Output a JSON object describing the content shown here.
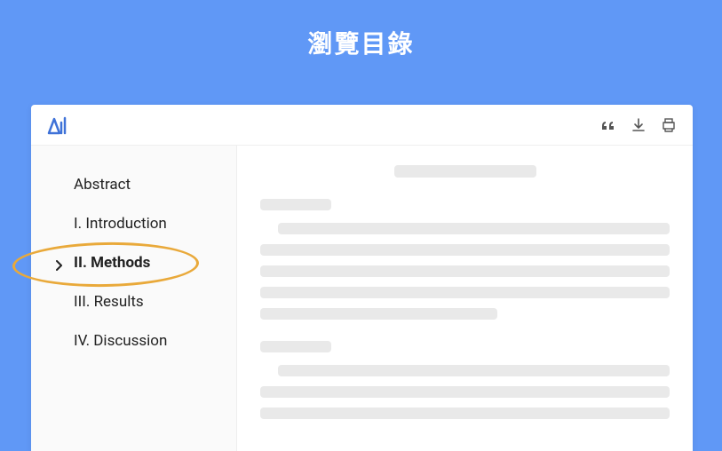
{
  "page": {
    "title": "瀏覽目錄"
  },
  "sidebar": {
    "items": [
      {
        "label": "Abstract",
        "active": false
      },
      {
        "label": "I. Introduction",
        "active": false
      },
      {
        "label": "II. Methods",
        "active": true
      },
      {
        "label": "III. Results",
        "active": false
      },
      {
        "label": "IV. Discussion",
        "active": false
      }
    ]
  },
  "colors": {
    "background": "#6098f6",
    "accent": "#3f72d8",
    "highlight": "#e9a93a"
  }
}
